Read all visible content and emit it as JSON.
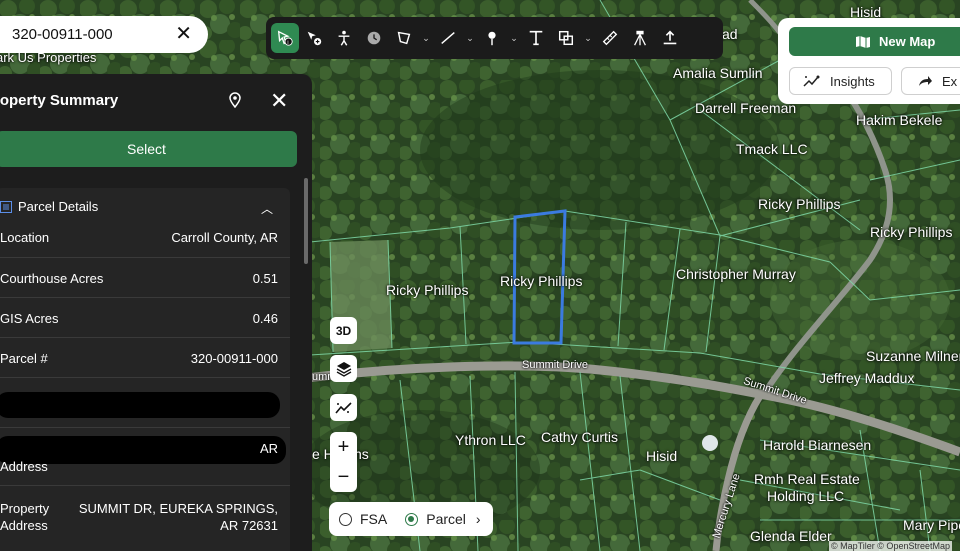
{
  "search": {
    "value": "320-00911-000",
    "clear_icon": "close-icon"
  },
  "toolbar": {
    "tools": [
      "identify-icon",
      "add-point-icon",
      "person-icon",
      "clock-icon",
      "polygon-icon",
      "line-icon",
      "pin-icon",
      "text-icon",
      "shape-icon",
      "ruler-icon",
      "survey-tripod-icon",
      "upload-icon"
    ],
    "active_color": "#2f8a52"
  },
  "actions": {
    "new_map": "New Map",
    "insights": "Insights",
    "export": "Ex"
  },
  "property_panel": {
    "title": "roperty Summary",
    "select_label": "Select",
    "section_title": "Parcel Details",
    "rows": [
      {
        "key": "Location",
        "value": "Carroll County, AR"
      },
      {
        "key": "Courthouse Acres",
        "value": "0.51"
      },
      {
        "key": "GIS Acres",
        "value": "0.46"
      },
      {
        "key": "Parcel #",
        "value": "320-00911-000"
      },
      {
        "key": "",
        "value": ""
      },
      {
        "key": "Address",
        "value": "AR"
      },
      {
        "key": "Property Address",
        "value": "SUMMIT DR, EUREKA SPRINGS, AR 72631"
      }
    ]
  },
  "map": {
    "labels": [
      "ark Us Properties",
      "Hisid",
      "ad",
      "Amalia Sumlin",
      "Darrell Freeman",
      "Hakim Bekele",
      "Tmack LLC",
      "Ricky Phillips",
      "Ricky Phillips",
      "Ricky Phillips",
      "Ricky Phillips",
      "Christopher Murray",
      "Suzanne Milner",
      "Jeffrey Maddux",
      "Harold Biarnesen",
      "Ythron LLC",
      "Cathy Curtis",
      "Hisid",
      "Rmh Real Estate",
      "Holding LLC",
      "Glenda Elder",
      "Mary Pipe",
      "e Hearns"
    ],
    "roads": [
      "Summit Drive",
      "Summit Drive",
      "umm    ive",
      "Mercury Lane"
    ],
    "attribution": "© MapTiler © OpenStreetMap",
    "selected_parcel_color": "#3b7be0",
    "parcel_line_color": "#7fd9a8"
  },
  "controls": {
    "view_3d": "3D",
    "layers_icon": "layers-icon",
    "analysis_icon": "trend-icon",
    "zoom_in": "+",
    "zoom_out": "−",
    "layer_options": [
      "FSA",
      "Parcel"
    ],
    "selected_layer": "Parcel"
  }
}
